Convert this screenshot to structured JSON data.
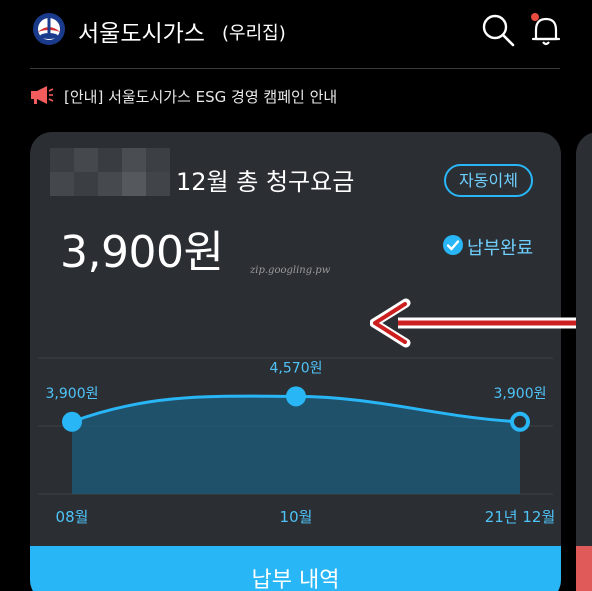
{
  "header": {
    "title": "서울도시가스",
    "subtitle": "(우리집)",
    "logo_icon": "seoul-city-gas-logo",
    "search_icon": "search-icon",
    "bell_icon": "bell-icon",
    "notification_dot_color": "#e74c3c"
  },
  "notice": {
    "icon": "megaphone-icon",
    "text": "[안내] 서울도시가스 ESG 경영 캠페인 안내"
  },
  "bill_card": {
    "title": "12월 총 청구요금",
    "auto_pay_label": "자동이체",
    "amount": "3,900원",
    "status_label": "납부완료",
    "watermark": "zip.googling.pw",
    "pay_history_label": "납부 내역"
  },
  "chart_data": {
    "type": "area",
    "categories": [
      "08월",
      "10월",
      "21년 12월"
    ],
    "values": [
      3900,
      4570,
      3900
    ],
    "data_labels": [
      "3,900원",
      "4,570원",
      "3,900원"
    ],
    "ylim": [
      2000,
      6000
    ],
    "grid": true,
    "title": "",
    "xlabel": "",
    "ylabel": "",
    "colors": {
      "line": "#29b6f6",
      "fill": "#1f5776"
    }
  },
  "colors": {
    "background": "#000000",
    "card": "#2b2e33",
    "accent": "#29b6f6",
    "arrow": "#cc1f1f"
  }
}
